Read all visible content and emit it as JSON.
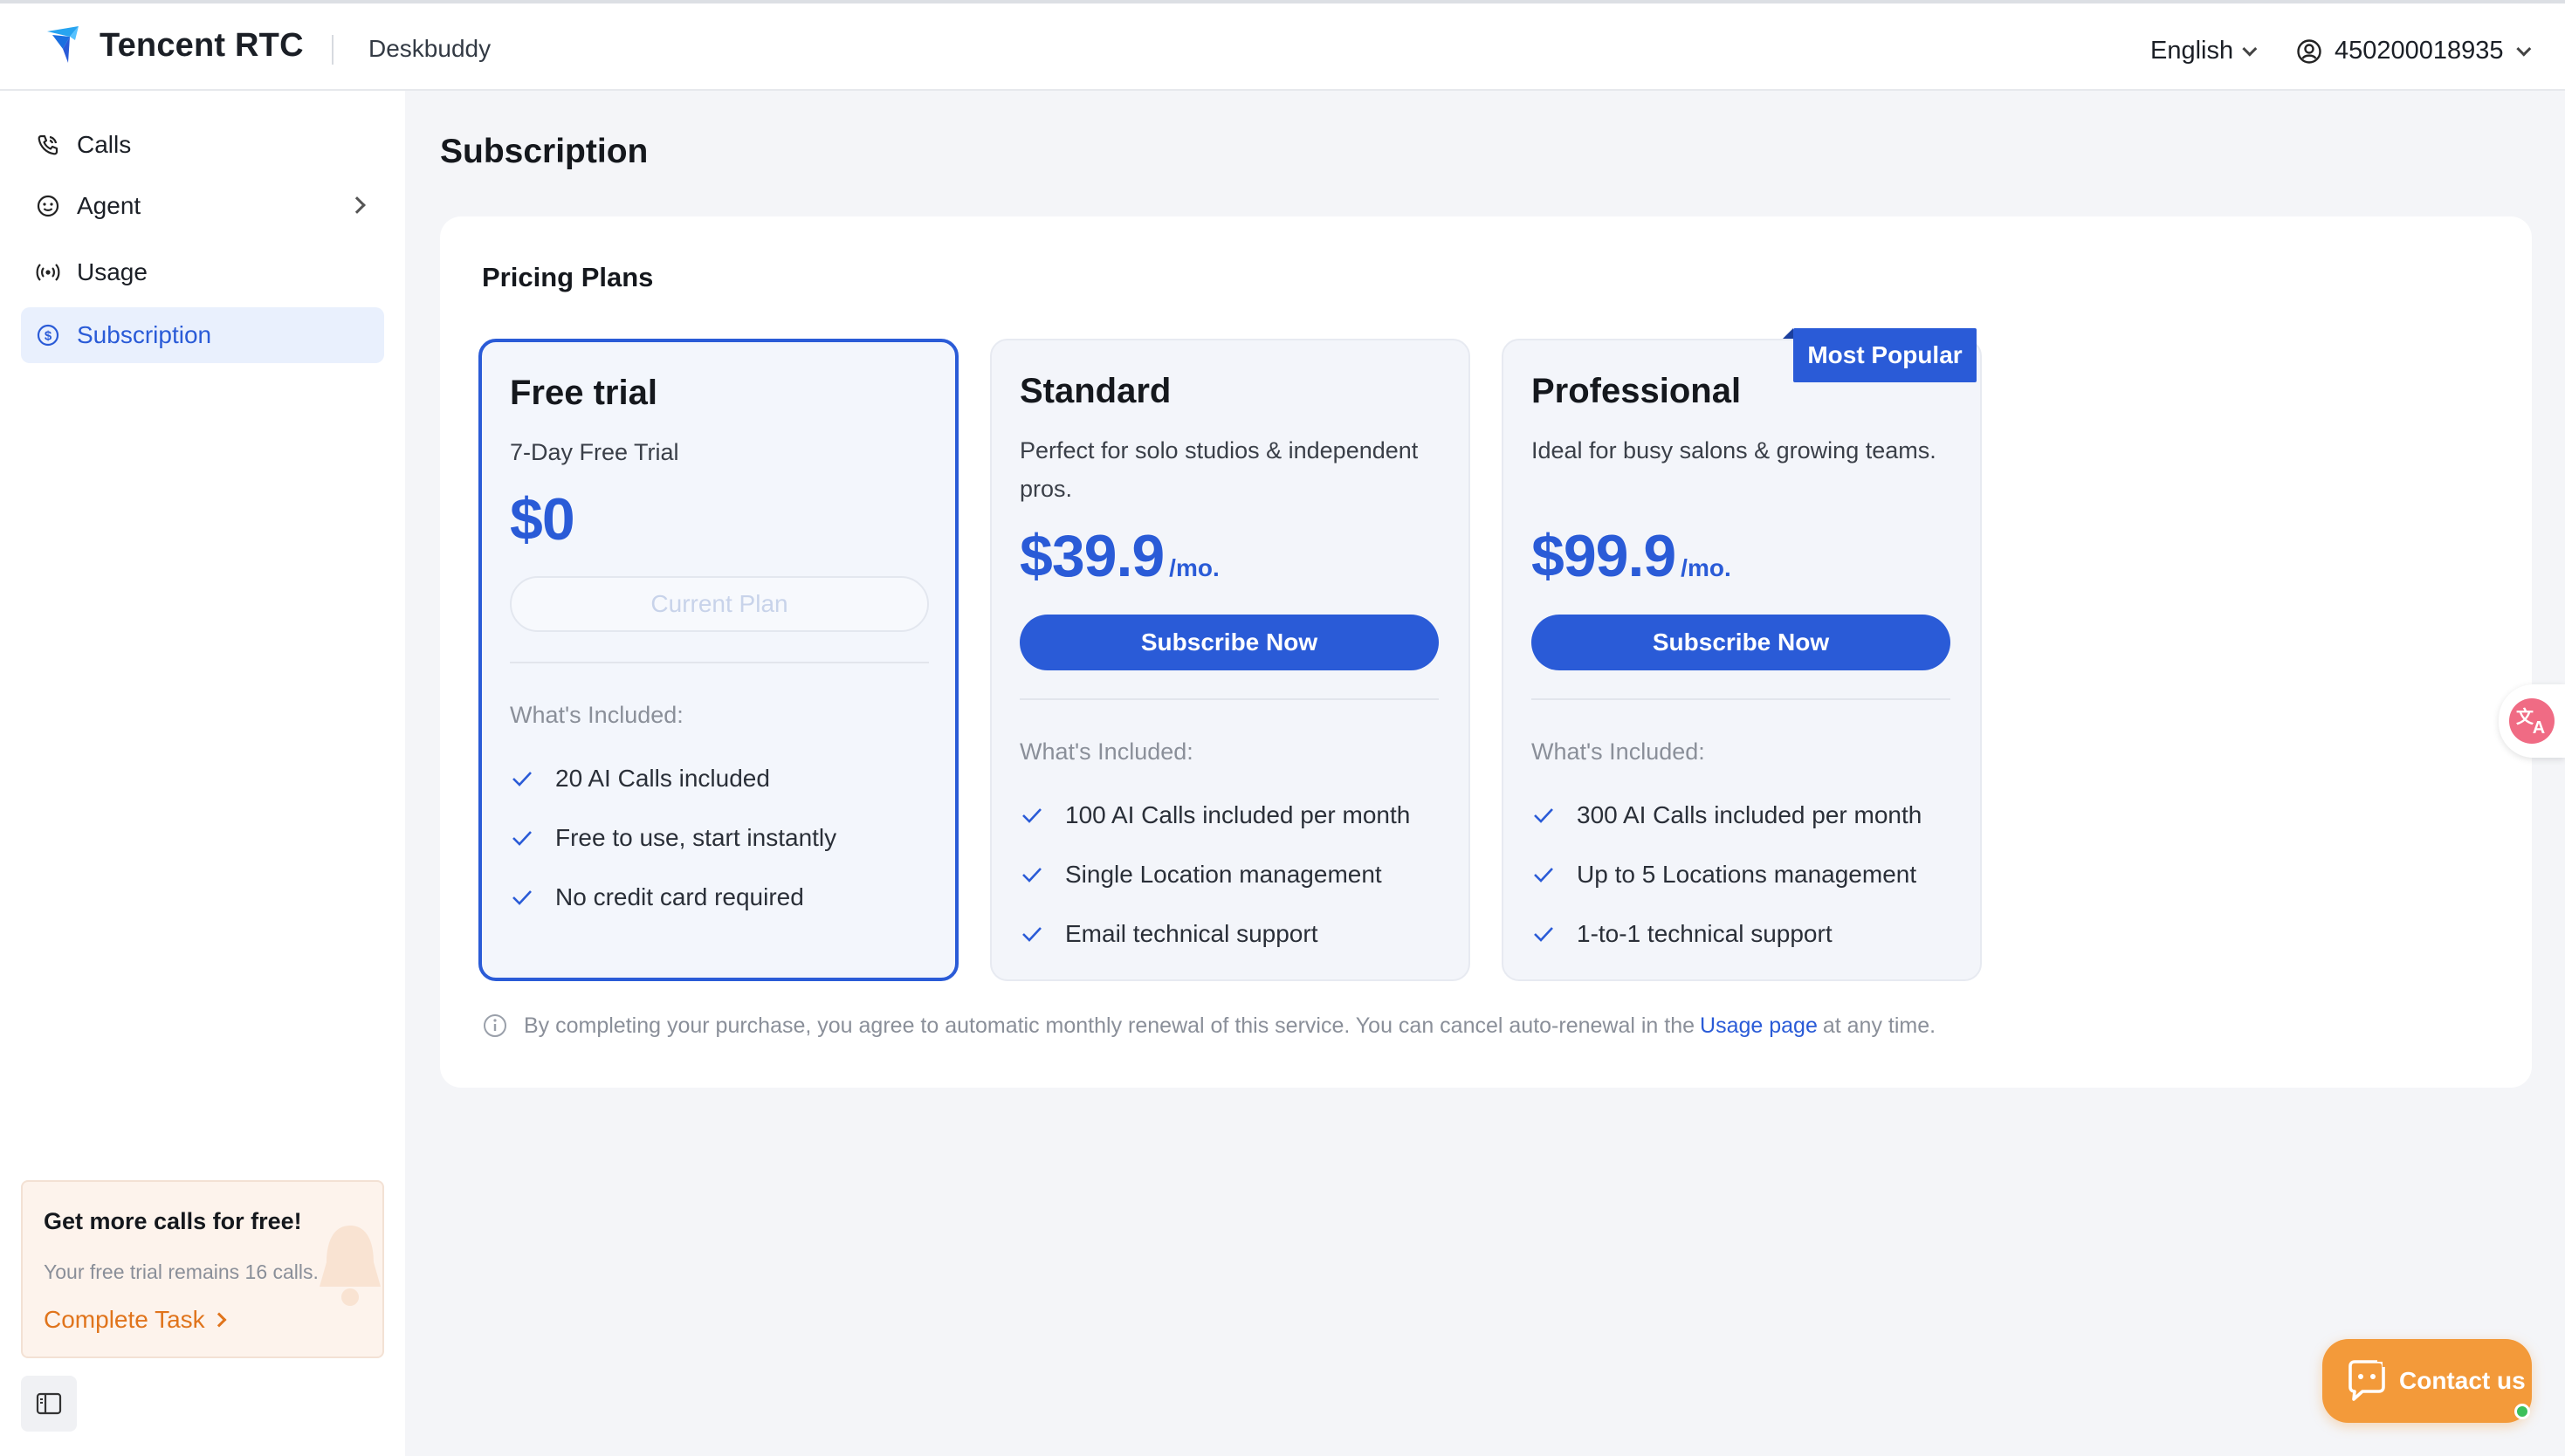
{
  "header": {
    "brand": "Tencent RTC",
    "app_name": "Deskbuddy",
    "language": "English",
    "account_id": "450200018935"
  },
  "sidebar": {
    "items": [
      {
        "label": "Calls",
        "icon": "phone-icon"
      },
      {
        "label": "Agent",
        "icon": "robot-icon"
      },
      {
        "label": "Usage",
        "icon": "signal-icon"
      },
      {
        "label": "Subscription",
        "icon": "dollar-icon",
        "active": true
      }
    ],
    "promo": {
      "title": "Get more calls for free!",
      "subtitle": "Your free trial remains 16 calls.",
      "link": "Complete Task"
    }
  },
  "main": {
    "title": "Subscription",
    "section_title": "Pricing Plans",
    "included_label": "What's Included:",
    "plans": [
      {
        "name": "Free trial",
        "description": "7-Day Free Trial",
        "price": "$0",
        "period": "",
        "button": "Current Plan",
        "features": [
          "20 AI Calls included",
          "Free to use, start instantly",
          "No credit card required"
        ]
      },
      {
        "name": "Standard",
        "description": "Perfect for solo studios & independent pros.",
        "price": "$39.9",
        "period": "/mo.",
        "button": "Subscribe Now",
        "features": [
          "100 AI Calls included per month",
          "Single Location management",
          "Email technical support"
        ]
      },
      {
        "name": "Professional",
        "description": "Ideal for busy salons & growing teams.",
        "price": "$99.9",
        "period": "/mo.",
        "button": "Subscribe Now",
        "badge": "Most Popular",
        "features": [
          "300 AI Calls included per month",
          "Up to 5 Locations management",
          "1-to-1 technical support"
        ]
      }
    ],
    "note": {
      "before": "By completing your purchase, you agree to automatic monthly renewal of this service. You can cancel auto-renewal in the",
      "link": "Usage page",
      "after": "at any time."
    }
  },
  "floating": {
    "contact": "Contact us"
  },
  "colors": {
    "accent": "#2a5bd7",
    "contact": "#f39a3a",
    "promo_link": "#e0741c"
  }
}
